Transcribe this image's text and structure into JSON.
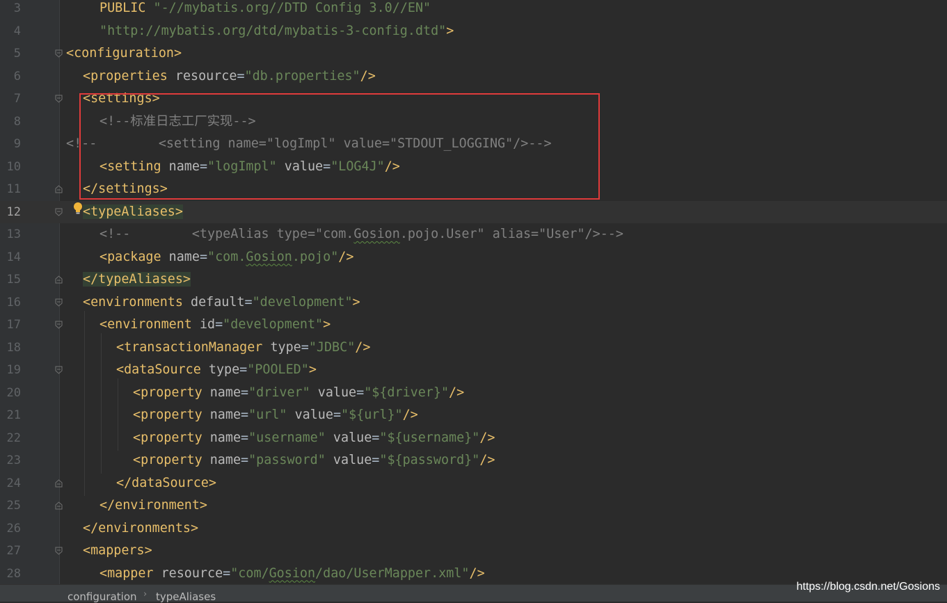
{
  "editor": {
    "current_line": 12,
    "lines": [
      {
        "n": 3,
        "indent": 4,
        "fold": "",
        "hl": false,
        "tokens": [
          [
            "doc",
            "PUBLIC "
          ],
          [
            "str",
            "\"-//mybatis.org//DTD Config 3.0//EN\""
          ]
        ]
      },
      {
        "n": 4,
        "indent": 4,
        "fold": "",
        "hl": false,
        "tokens": [
          [
            "str",
            "\"http://mybatis.org/dtd/mybatis-3-config.dtd\""
          ],
          [
            "doc",
            ">"
          ]
        ]
      },
      {
        "n": 5,
        "indent": 0,
        "fold": "open",
        "hl": false,
        "tokens": [
          [
            "tag",
            "<configuration>"
          ]
        ]
      },
      {
        "n": 6,
        "indent": 2,
        "fold": "",
        "hl": false,
        "tokens": [
          [
            "tag",
            "<properties "
          ],
          [
            "attr",
            "resource"
          ],
          [
            "txt",
            "="
          ],
          [
            "str",
            "\"db.properties\""
          ],
          [
            "tag",
            "/>"
          ]
        ]
      },
      {
        "n": 7,
        "indent": 2,
        "fold": "open",
        "hl": false,
        "tokens": [
          [
            "tag",
            "<settings>"
          ]
        ]
      },
      {
        "n": 8,
        "indent": 4,
        "fold": "",
        "hl": false,
        "tokens": [
          [
            "cmt",
            "<!--标准日志工厂实现-->"
          ]
        ]
      },
      {
        "n": 9,
        "indent": 0,
        "fold": "",
        "hl": false,
        "tokens": [
          [
            "cmt",
            "<!--        <setting name=\"logImpl\" value=\"STDOUT_LOGGING\"/>-->"
          ]
        ]
      },
      {
        "n": 10,
        "indent": 4,
        "fold": "",
        "hl": false,
        "tokens": [
          [
            "tag",
            "<setting "
          ],
          [
            "attr",
            "name"
          ],
          [
            "txt",
            "="
          ],
          [
            "str",
            "\"logImpl\""
          ],
          [
            "txt",
            " "
          ],
          [
            "attr",
            "value"
          ],
          [
            "txt",
            "="
          ],
          [
            "str",
            "\"LOG4J\""
          ],
          [
            "tag",
            "/>"
          ]
        ]
      },
      {
        "n": 11,
        "indent": 2,
        "fold": "close",
        "hl": false,
        "tokens": [
          [
            "tag",
            "</settings>"
          ]
        ]
      },
      {
        "n": 12,
        "indent": 2,
        "fold": "open",
        "hl": true,
        "tokens": [
          [
            "tag",
            "<typeAliases>"
          ]
        ]
      },
      {
        "n": 13,
        "indent": 4,
        "fold": "",
        "hl": false,
        "tokens": [
          [
            "cmt",
            "<!--        <typeAlias type=\"com."
          ],
          [
            "cmt-sq",
            "Gosion"
          ],
          [
            "cmt",
            ".pojo.User\" alias=\"User\"/>-->"
          ]
        ]
      },
      {
        "n": 14,
        "indent": 4,
        "fold": "",
        "hl": false,
        "tokens": [
          [
            "tag",
            "<package "
          ],
          [
            "attr",
            "name"
          ],
          [
            "txt",
            "="
          ],
          [
            "str",
            "\"com."
          ],
          [
            "str-sq",
            "Gosion"
          ],
          [
            "str",
            ".pojo\""
          ],
          [
            "tag",
            "/>"
          ]
        ]
      },
      {
        "n": 15,
        "indent": 2,
        "fold": "close",
        "hl": true,
        "tokens": [
          [
            "tag",
            "</typeAliases>"
          ]
        ]
      },
      {
        "n": 16,
        "indent": 2,
        "fold": "open",
        "hl": false,
        "tokens": [
          [
            "tag",
            "<environments "
          ],
          [
            "attr",
            "default"
          ],
          [
            "txt",
            "="
          ],
          [
            "str",
            "\"development\""
          ],
          [
            "tag",
            ">"
          ]
        ]
      },
      {
        "n": 17,
        "indent": 4,
        "fold": "open",
        "hl": false,
        "tokens": [
          [
            "tag",
            "<environment "
          ],
          [
            "attr",
            "id"
          ],
          [
            "txt",
            "="
          ],
          [
            "str",
            "\"development\""
          ],
          [
            "tag",
            ">"
          ]
        ]
      },
      {
        "n": 18,
        "indent": 6,
        "fold": "",
        "hl": false,
        "tokens": [
          [
            "tag",
            "<transactionManager "
          ],
          [
            "attr",
            "type"
          ],
          [
            "txt",
            "="
          ],
          [
            "str",
            "\"JDBC\""
          ],
          [
            "tag",
            "/>"
          ]
        ]
      },
      {
        "n": 19,
        "indent": 6,
        "fold": "open",
        "hl": false,
        "tokens": [
          [
            "tag",
            "<dataSource "
          ],
          [
            "attr",
            "type"
          ],
          [
            "txt",
            "="
          ],
          [
            "str",
            "\"POOLED\""
          ],
          [
            "tag",
            ">"
          ]
        ]
      },
      {
        "n": 20,
        "indent": 8,
        "fold": "",
        "hl": false,
        "tokens": [
          [
            "tag",
            "<property "
          ],
          [
            "attr",
            "name"
          ],
          [
            "txt",
            "="
          ],
          [
            "str",
            "\"driver\""
          ],
          [
            "txt",
            " "
          ],
          [
            "attr",
            "value"
          ],
          [
            "txt",
            "="
          ],
          [
            "str",
            "\"${driver}\""
          ],
          [
            "tag",
            "/>"
          ]
        ]
      },
      {
        "n": 21,
        "indent": 8,
        "fold": "",
        "hl": false,
        "tokens": [
          [
            "tag",
            "<property "
          ],
          [
            "attr",
            "name"
          ],
          [
            "txt",
            "="
          ],
          [
            "str",
            "\"url\""
          ],
          [
            "txt",
            " "
          ],
          [
            "attr",
            "value"
          ],
          [
            "txt",
            "="
          ],
          [
            "str",
            "\"${url}\""
          ],
          [
            "tag",
            "/>"
          ]
        ]
      },
      {
        "n": 22,
        "indent": 8,
        "fold": "",
        "hl": false,
        "tokens": [
          [
            "tag",
            "<property "
          ],
          [
            "attr",
            "name"
          ],
          [
            "txt",
            "="
          ],
          [
            "str",
            "\"username\""
          ],
          [
            "txt",
            " "
          ],
          [
            "attr",
            "value"
          ],
          [
            "txt",
            "="
          ],
          [
            "str",
            "\"${username}\""
          ],
          [
            "tag",
            "/>"
          ]
        ]
      },
      {
        "n": 23,
        "indent": 8,
        "fold": "",
        "hl": false,
        "tokens": [
          [
            "tag",
            "<property "
          ],
          [
            "attr",
            "name"
          ],
          [
            "txt",
            "="
          ],
          [
            "str",
            "\"password\""
          ],
          [
            "txt",
            " "
          ],
          [
            "attr",
            "value"
          ],
          [
            "txt",
            "="
          ],
          [
            "str",
            "\"${password}\""
          ],
          [
            "tag",
            "/>"
          ]
        ]
      },
      {
        "n": 24,
        "indent": 6,
        "fold": "close",
        "hl": false,
        "tokens": [
          [
            "tag",
            "</dataSource>"
          ]
        ]
      },
      {
        "n": 25,
        "indent": 4,
        "fold": "close",
        "hl": false,
        "tokens": [
          [
            "tag",
            "</environment>"
          ]
        ]
      },
      {
        "n": 26,
        "indent": 2,
        "fold": "",
        "hl": false,
        "tokens": [
          [
            "tag",
            "</environments>"
          ]
        ]
      },
      {
        "n": 27,
        "indent": 2,
        "fold": "open",
        "hl": false,
        "tokens": [
          [
            "tag",
            "<mappers>"
          ]
        ]
      },
      {
        "n": 28,
        "indent": 4,
        "fold": "",
        "hl": false,
        "tokens": [
          [
            "tag",
            "<mapper "
          ],
          [
            "attr",
            "resource"
          ],
          [
            "txt",
            "="
          ],
          [
            "str",
            "\"com/"
          ],
          [
            "str-sq",
            "Gosion"
          ],
          [
            "str",
            "/dao/UserMapper.xml\""
          ],
          [
            "tag",
            "/>"
          ]
        ]
      }
    ]
  },
  "breadcrumb": [
    "configuration",
    "typeAliases"
  ],
  "watermark": "https://blog.csdn.net/Gosions",
  "icons": {
    "intention": "lightbulb-icon",
    "fold_open": "fold-open-icon",
    "fold_close": "fold-close-icon"
  },
  "colors": {
    "background": "#2b2b2b",
    "tag": "#e8bf6a",
    "string": "#6a8759",
    "comment": "#808080",
    "highlight_box": "#e03b3b"
  }
}
